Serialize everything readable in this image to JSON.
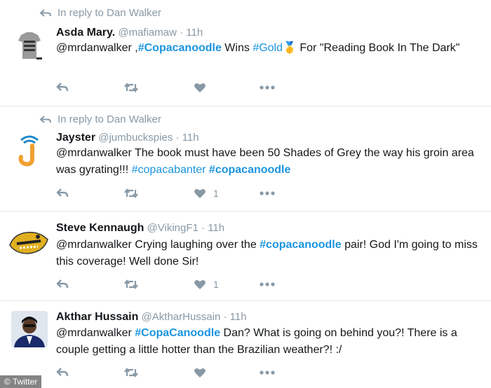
{
  "tweets": [
    {
      "reply_to": "In reply to Dan Walker",
      "name": "Asda Mary.",
      "handle": "@mafiamaw",
      "sep": "·",
      "time": "11h",
      "parts": [
        {
          "t": "@mrdanwalker",
          "c": "mention"
        },
        {
          "t": " ,",
          "c": ""
        },
        {
          "t": "#Copacanoodle",
          "c": "hashtag bold"
        },
        {
          "t": " Wins ",
          "c": ""
        },
        {
          "t": "#Gold",
          "c": "hashtag"
        },
        {
          "t": "🥇",
          "c": "medal"
        },
        {
          "t": " For \"Reading Book In The Dark\"",
          "c": ""
        }
      ],
      "like_count": ""
    },
    {
      "reply_to": "In reply to Dan Walker",
      "name": "Jayster",
      "handle": "@jumbuckspies",
      "sep": "·",
      "time": "11h",
      "parts": [
        {
          "t": "@mrdanwalker",
          "c": "mention"
        },
        {
          "t": " The book must have been 50 Shades of Grey the way his groin area was gyrating!!! ",
          "c": ""
        },
        {
          "t": "#copacabanter",
          "c": "hashtag"
        },
        {
          "t": " ",
          "c": ""
        },
        {
          "t": "#copacanoodle",
          "c": "hashtag bold"
        }
      ],
      "like_count": "1"
    },
    {
      "reply_to": "",
      "name": "Steve Kennaugh",
      "handle": "@VikingF1",
      "sep": "·",
      "time": "11h",
      "parts": [
        {
          "t": "@mrdanwalker",
          "c": "mention"
        },
        {
          "t": " Crying laughing over the ",
          "c": ""
        },
        {
          "t": "#copacanoodle",
          "c": "hashtag bold"
        },
        {
          "t": " pair! God I'm going to miss this coverage! Well done Sir!",
          "c": ""
        }
      ],
      "like_count": "1"
    },
    {
      "reply_to": "",
      "name": "Akthar Hussain",
      "handle": "@AktharHussain",
      "sep": "·",
      "time": "11h",
      "parts": [
        {
          "t": "@mrdanwalker",
          "c": "mention"
        },
        {
          "t": " ",
          "c": ""
        },
        {
          "t": "#CopaCanoodle",
          "c": "hashtag bold"
        },
        {
          "t": " Dan? What is going on behind you?! There is a couple getting a little hotter than the Brazilian weather?! :/",
          "c": ""
        }
      ],
      "like_count": ""
    }
  ],
  "credit": "© Twitter",
  "colors": {
    "accent": "#1b95e0",
    "muted": "#8899a6",
    "text": "#14171a"
  },
  "icons": [
    "reply-arrow-icon",
    "reply-icon",
    "retweet-icon",
    "like-icon",
    "more-icon"
  ]
}
